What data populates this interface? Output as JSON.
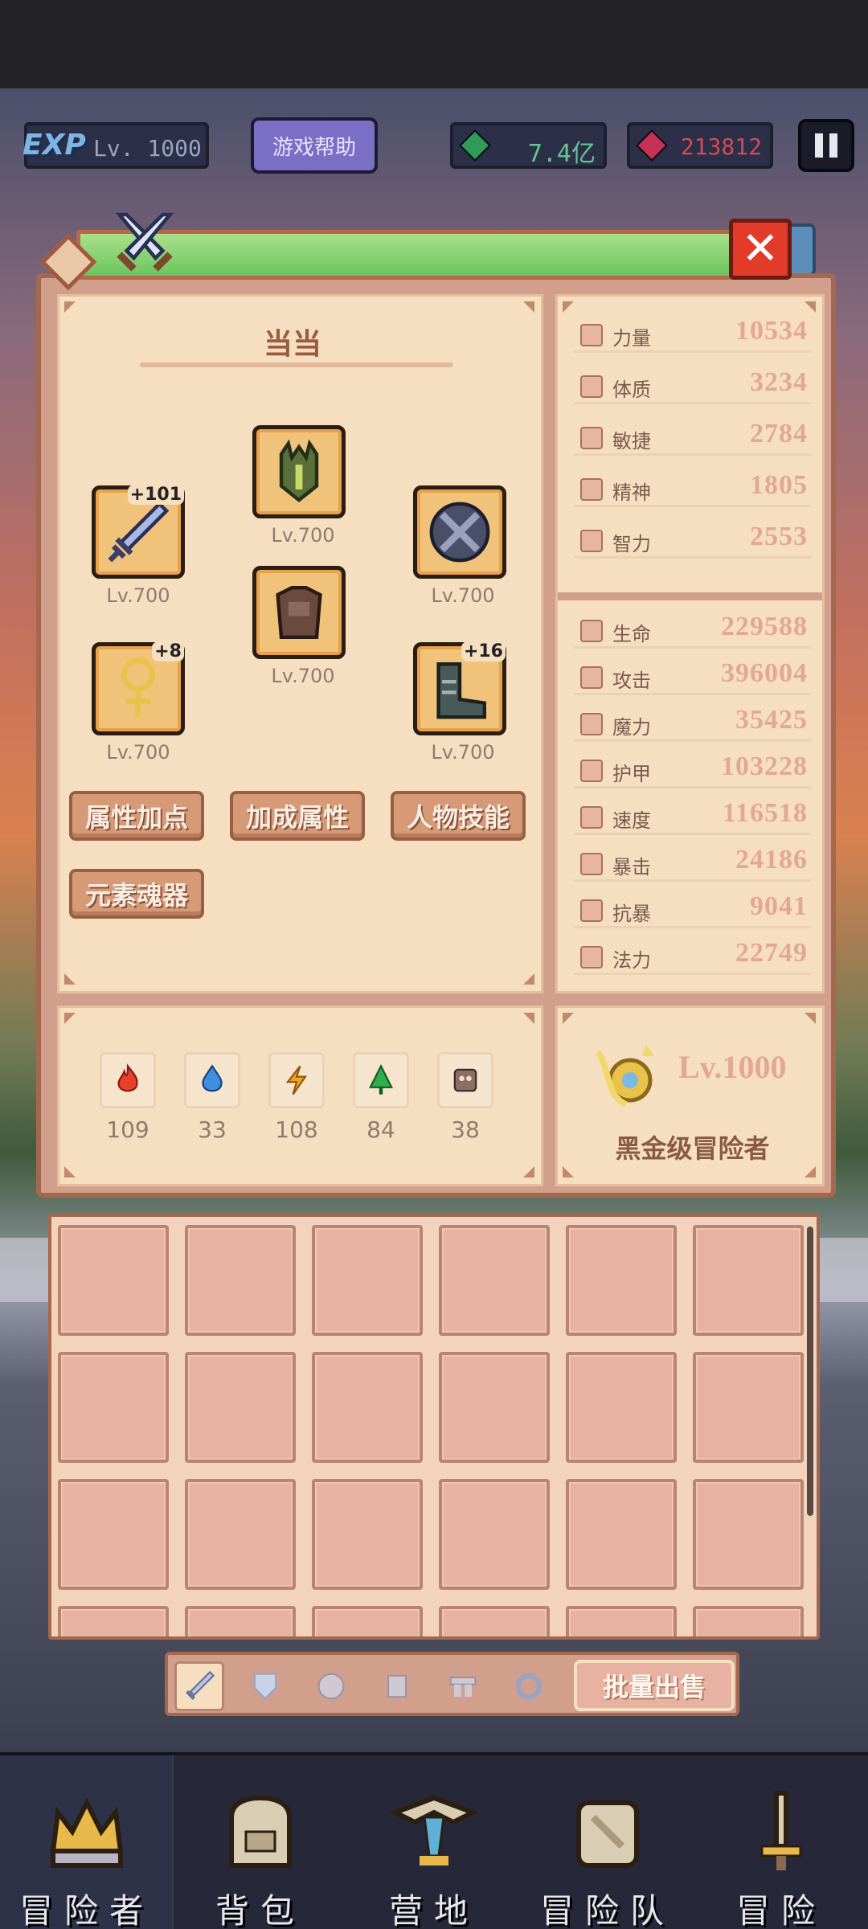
{
  "hud": {
    "exp_badge": "EXP",
    "level": "Lv. 1000",
    "help_button": "游戏帮助",
    "green_gems": "7.4亿",
    "red_gems": "213812"
  },
  "character": {
    "name": "当当",
    "equipment": [
      {
        "slot": "weapon",
        "icon": "sword-icon",
        "plus": "+101",
        "level": "Lv.700"
      },
      {
        "slot": "helmet",
        "icon": "helmet-icon",
        "plus": "",
        "level": "Lv.700"
      },
      {
        "slot": "shield",
        "icon": "shield-icon",
        "plus": "",
        "level": "Lv.700"
      },
      {
        "slot": "armor",
        "icon": "armor-icon",
        "plus": "",
        "level": "Lv.700"
      },
      {
        "slot": "accessory",
        "icon": "amulet-icon",
        "plus": "+8",
        "level": "Lv.700"
      },
      {
        "slot": "boots",
        "icon": "boots-icon",
        "plus": "+16",
        "level": "Lv.700"
      }
    ],
    "buttons": [
      "属性加点",
      "加成属性",
      "人物技能",
      "元素魂器"
    ],
    "elements": [
      {
        "icon": "fire-element-icon",
        "color": "#e8402a",
        "count": "109"
      },
      {
        "icon": "water-element-icon",
        "color": "#3d8fe0",
        "count": "33"
      },
      {
        "icon": "lightning-element-icon",
        "color": "#f0a325",
        "count": "108"
      },
      {
        "icon": "nature-element-icon",
        "color": "#2fae4a",
        "count": "84"
      },
      {
        "icon": "dark-element-icon",
        "color": "#8a6e64",
        "count": "38"
      }
    ]
  },
  "base_stats": [
    {
      "label": "力量",
      "value": "10534"
    },
    {
      "label": "体质",
      "value": "3234"
    },
    {
      "label": "敏捷",
      "value": "2784"
    },
    {
      "label": "精神",
      "value": "1805"
    },
    {
      "label": "智力",
      "value": "2553"
    }
  ],
  "combat_stats": [
    {
      "label": "生命",
      "value": "229588"
    },
    {
      "label": "攻击",
      "value": "396004"
    },
    {
      "label": "魔力",
      "value": "35425"
    },
    {
      "label": "护甲",
      "value": "103228"
    },
    {
      "label": "速度",
      "value": "116518"
    },
    {
      "label": "暴击",
      "value": "24186"
    },
    {
      "label": "抗暴",
      "value": "9041"
    },
    {
      "label": "法力",
      "value": "22749"
    }
  ],
  "rank": {
    "level": "Lv.1000",
    "title": "黑金级冒险者"
  },
  "inventory": {
    "columns": 6,
    "tabs": [
      "sword-tab-icon",
      "shield-tab-icon",
      "helmet-tab-icon",
      "armor-tab-icon",
      "boots-tab-icon",
      "ring-tab-icon"
    ],
    "sell_button": "批量出售"
  },
  "bottom_nav": [
    {
      "label": "冒险者",
      "icon": "crown-icon"
    },
    {
      "label": "背包",
      "icon": "backpack-icon"
    },
    {
      "label": "营地",
      "icon": "camp-icon"
    },
    {
      "label": "冒险队",
      "icon": "party-icon"
    },
    {
      "label": "冒险",
      "icon": "adventure-icon"
    }
  ],
  "colors": {
    "panel": "#f6dfc0",
    "frame": "#a4684f",
    "stat_value": "#e3a796",
    "title_bar": "#8fd277",
    "close": "#e33b2a"
  }
}
